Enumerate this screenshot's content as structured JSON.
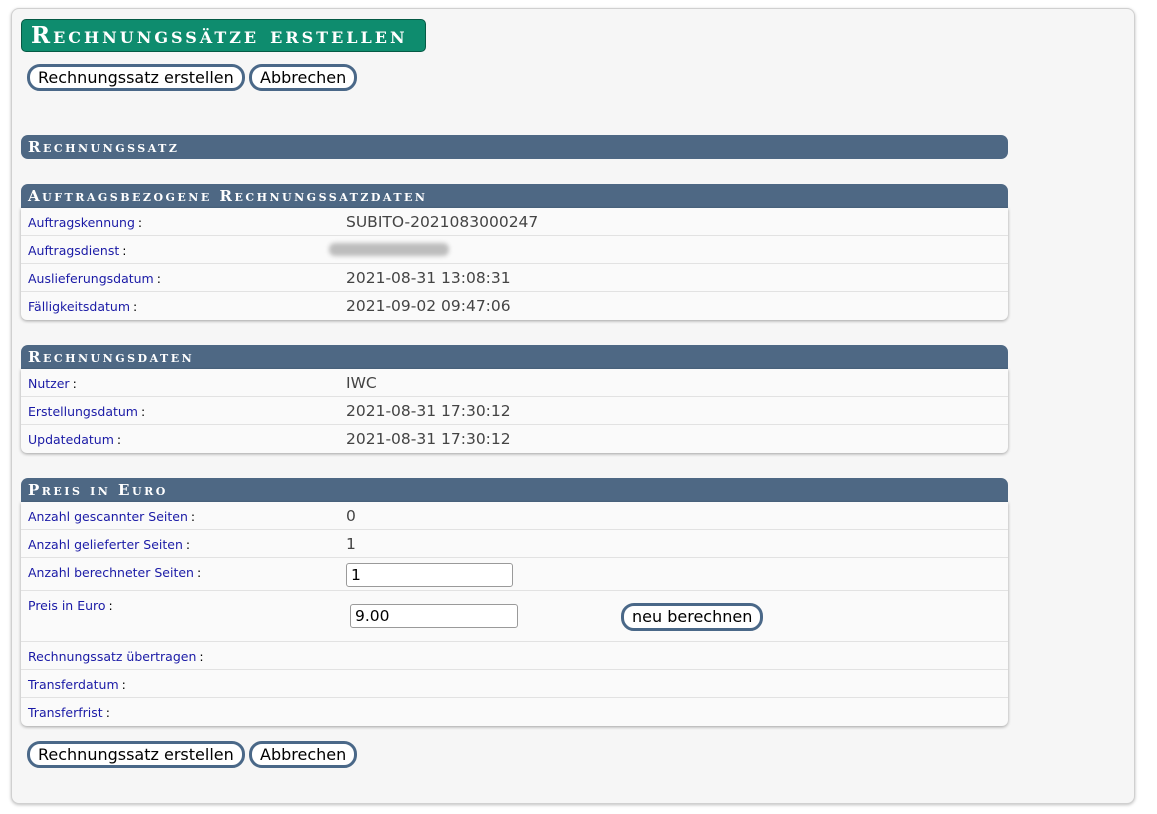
{
  "page_title": "Rechnungssätze erstellen",
  "actions": {
    "create_label": "Rechnungssatz erstellen",
    "cancel_label": "Abbrechen"
  },
  "section_rechnungssatz": {
    "title": "Rechnungssatz"
  },
  "section_auftrag": {
    "title": "Auftragsbezogene Rechnungssatzdaten",
    "rows": [
      {
        "label": "Auftragskennung",
        "value": "SUBITO-2021083000247"
      },
      {
        "label": "Auftragsdienst",
        "value": ""
      },
      {
        "label": "Auslieferungsdatum",
        "value": "2021-08-31 13:08:31"
      },
      {
        "label": "Fälligkeitsdatum",
        "value": "2021-09-02 09:47:06"
      }
    ]
  },
  "section_rechnung": {
    "title": "Rechnungsdaten",
    "rows": [
      {
        "label": "Nutzer",
        "value": "IWC"
      },
      {
        "label": "Erstellungsdatum",
        "value": "2021-08-31 17:30:12"
      },
      {
        "label": "Updatedatum",
        "value": "2021-08-31 17:30:12"
      }
    ]
  },
  "section_preis": {
    "title": "Preis in Euro",
    "rows": [
      {
        "label": "Anzahl gescannter Seiten",
        "value": "0"
      },
      {
        "label": "Anzahl gelieferter Seiten",
        "value": "1"
      },
      {
        "label": "Anzahl berechneter Seiten",
        "input_value": "1"
      },
      {
        "label": "Preis in Euro",
        "input_value": "9.00",
        "button_label": "neu berechnen"
      },
      {
        "label": "Rechnungssatz übertragen",
        "value": ""
      },
      {
        "label": "Transferdatum",
        "value": ""
      },
      {
        "label": "Transferfrist",
        "value": ""
      }
    ]
  }
}
